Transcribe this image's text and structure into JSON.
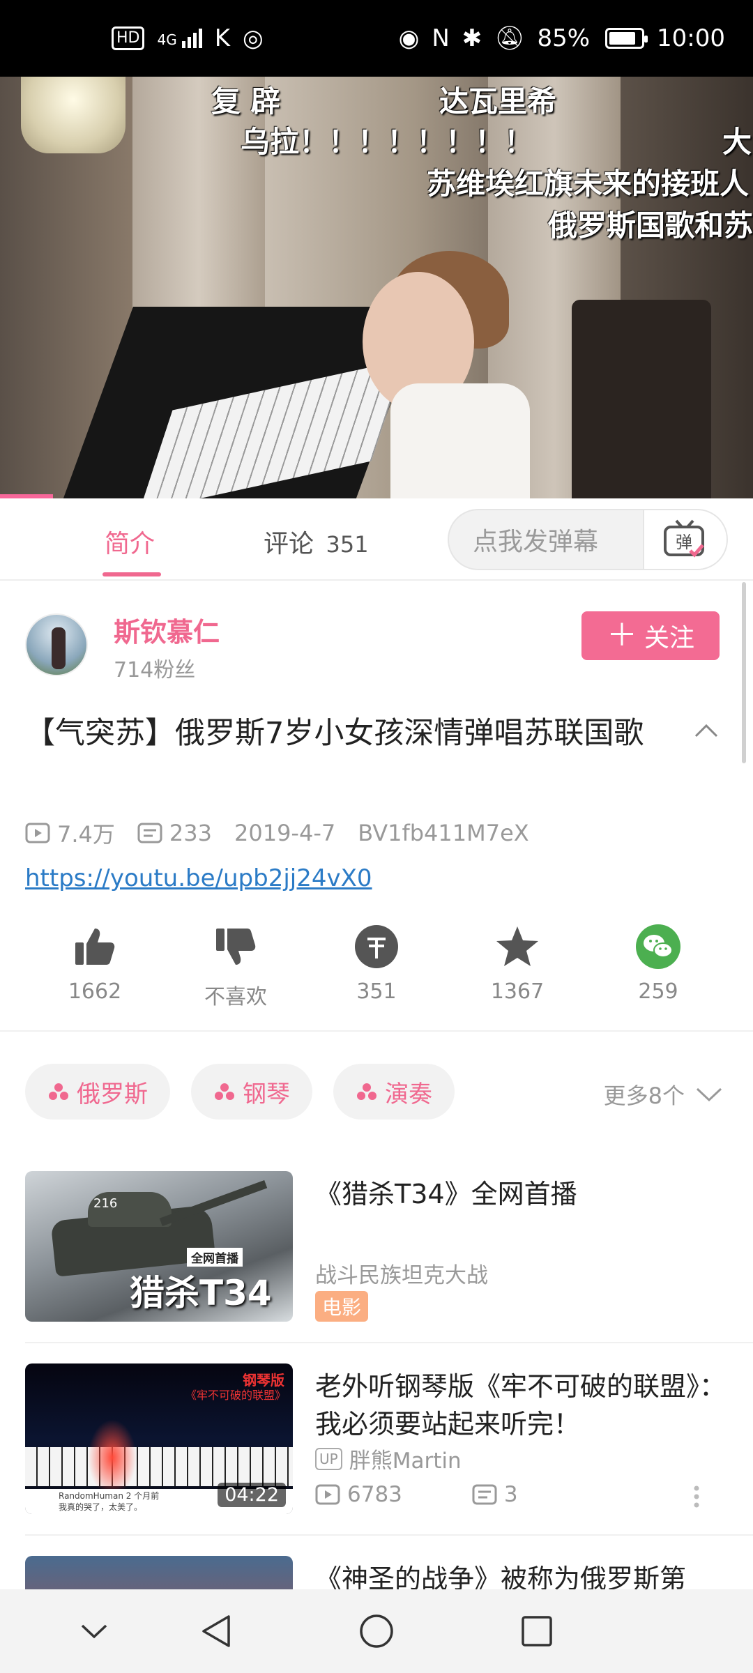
{
  "status_bar": {
    "hd_label": "HD",
    "network_label": "4G",
    "battery_percent": 85,
    "battery_text": "85%",
    "time": "10:00"
  },
  "video": {
    "danmaku": [
      "复 辟",
      "达瓦里希",
      "乌拉！！！！！！！！",
      "大",
      "苏维埃红旗未来的接班人",
      "俄罗斯国歌和苏"
    ],
    "progress_fraction": 0.07
  },
  "tabs": {
    "intro_label": "简介",
    "comments_label": "评论",
    "comments_count": "351",
    "danmu_placeholder": "点我发弹幕",
    "danmu_button_glyph": "弹"
  },
  "uploader": {
    "name": "斯钦慕仁",
    "fans": "714粉丝",
    "follow_label": "关注"
  },
  "video_info": {
    "title": "【气突苏】俄罗斯7岁小女孩深情弹唱苏联国歌",
    "views": "7.4万",
    "danmaku_count": "233",
    "date": "2019-4-7",
    "bvid": "BV1fb411M7eX",
    "link": "https://youtu.be/upb2jj24vX0"
  },
  "actions": [
    {
      "name": "like",
      "label": "1662",
      "icon": "thumbs-up-icon"
    },
    {
      "name": "dislike",
      "label": "不喜欢",
      "icon": "thumbs-down-icon"
    },
    {
      "name": "coin",
      "label": "351",
      "icon": "coin-icon"
    },
    {
      "name": "favorite",
      "label": "1367",
      "icon": "star-icon"
    },
    {
      "name": "share",
      "label": "259",
      "icon": "wechat-icon"
    }
  ],
  "tags": [
    "俄罗斯",
    "钢琴",
    "演奏"
  ],
  "more_tags": "更多8个",
  "related": [
    {
      "title": "《猎杀T34》全网首播",
      "subtitle": "战斗民族坦克大战",
      "badge": "电影",
      "thumb_text_small": "全网首播",
      "thumb_text_big": "猎杀T34",
      "thumb_tank_number": "216"
    },
    {
      "title": "老外听钢琴版《牢不可破的联盟》：我必须要站起来听完！",
      "up_badge": "UP",
      "uploader": "胖熊Martin",
      "views": "6783",
      "danmaku": "3",
      "duration": "04:22",
      "thumb_caption_top": "钢琴版",
      "thumb_caption": "《牢不可破的联盟》",
      "thumb_comment_user": "RandomHuman 2 个月前",
      "thumb_comment_text": "我真的哭了，太美了。"
    },
    {
      "title": "《神圣的战争》被称为俄罗斯第"
    }
  ],
  "colors": {
    "accent": "#f0688f",
    "follow_button": "#f36b93",
    "link": "#2b7bc6",
    "wechat": "#4caf50",
    "badge": "#fbae82"
  }
}
